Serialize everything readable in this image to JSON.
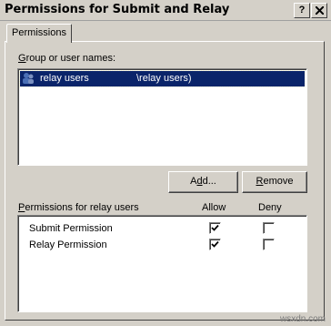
{
  "window": {
    "title": "Permissions for Submit and Relay",
    "help_label": "?",
    "close_label": "X"
  },
  "tabs": [
    {
      "label": "Permissions"
    }
  ],
  "group_list": {
    "label": "Group or user names:",
    "items": [
      {
        "name": "relay users",
        "domain": "\\relay users)",
        "selected": true
      }
    ]
  },
  "buttons": {
    "add": "Add...",
    "remove": "Remove"
  },
  "permissions": {
    "header": "Permissions for relay users",
    "allow_label": "Allow",
    "deny_label": "Deny",
    "rows": [
      {
        "name": "Submit Permission",
        "allow": true,
        "deny": false
      },
      {
        "name": "Relay Permission",
        "allow": true,
        "deny": false
      }
    ]
  },
  "watermark": "wsxdn.com"
}
